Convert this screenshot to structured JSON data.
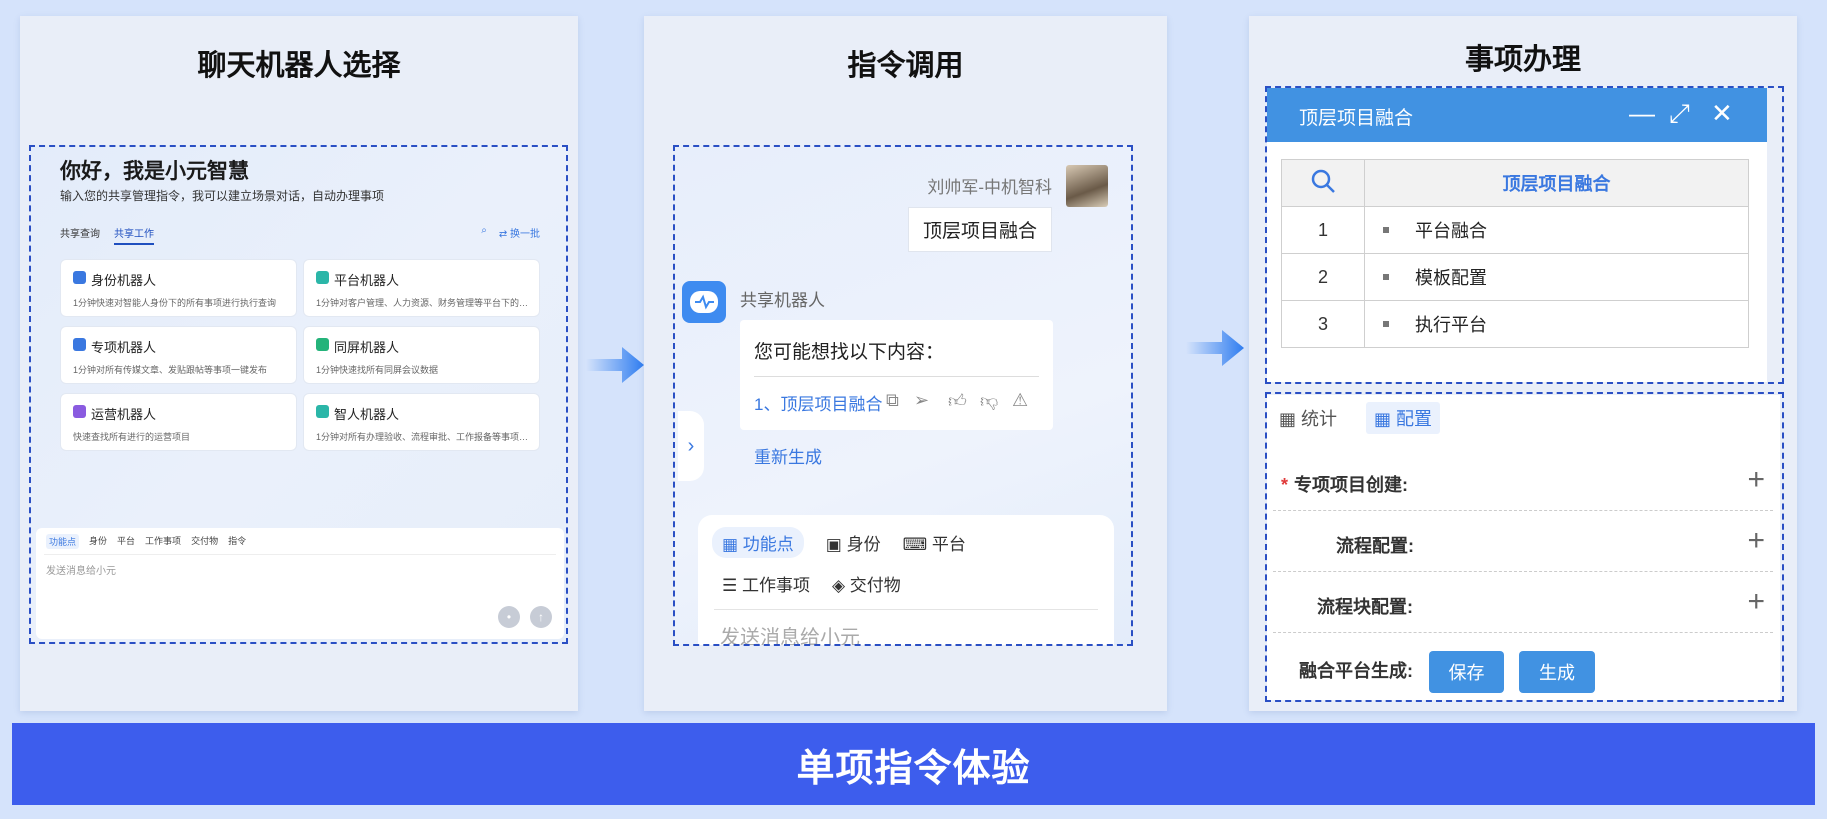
{
  "panel1": {
    "title": "聊天机器人选择",
    "greeting": "你好，我是小元智慧",
    "subtitle": "输入您的共享管理指令，我可以建立场景对话，自动办理事项",
    "tabs": [
      "共享查询",
      "共享工作"
    ],
    "refresh": "换一批",
    "cards": [
      {
        "title": "身份机器人",
        "desc": "1分钟快速对智能人身份下的所有事项进行执行查询",
        "color": "#3a78e0"
      },
      {
        "title": "平台机器人",
        "desc": "1分钟对客户管理、人力资源、财务管理等平台下的所有事...",
        "color": "#2bb6a8"
      },
      {
        "title": "专项机器人",
        "desc": "1分钟对所有传媒文章、发贴跟帖等事项一键发布",
        "color": "#3a78e0"
      },
      {
        "title": "同屏机器人",
        "desc": "1分钟快速找所有同屏会议数据",
        "color": "#24b37a"
      },
      {
        "title": "运营机器人",
        "desc": "快速查找所有进行的运营项目",
        "color": "#8a5be0"
      },
      {
        "title": "智人机器人",
        "desc": "1分钟对所有办理验收、流程审批、工作报备等事项一键办...",
        "color": "#2bb6a8"
      }
    ],
    "input_tabs": [
      "功能点",
      "身份",
      "平台",
      "工作事项",
      "交付物",
      "指令"
    ],
    "placeholder": "发送消息给小元"
  },
  "panel2": {
    "title": "指令调用",
    "user_name": "刘帅军-中机智科",
    "user_message": "顶层项目融合",
    "bot_name": "共享机器人",
    "bot_intro": "您可能想找以下内容：",
    "bot_item": "1、顶层项目融合",
    "regenerate": "重新生成",
    "input_tabs_row1": [
      "功能点",
      "身份",
      "平台"
    ],
    "input_tabs_row2": [
      "工作事项",
      "交付物"
    ],
    "placeholder": "发送消息给小元"
  },
  "panel3": {
    "title": "事项办理",
    "window_title": "顶层项目融合",
    "table_header": "顶层项目融合",
    "rows": [
      {
        "n": "1",
        "v": "平台融合"
      },
      {
        "n": "2",
        "v": "模板配置"
      },
      {
        "n": "3",
        "v": "执行平台"
      }
    ],
    "tabs": [
      "统计",
      "配置"
    ],
    "fields": [
      "专项项目创建:",
      "流程配置:",
      "流程块配置:",
      "融合平台生成:"
    ],
    "save": "保存",
    "generate": "生成"
  },
  "banner": "单项指令体验"
}
